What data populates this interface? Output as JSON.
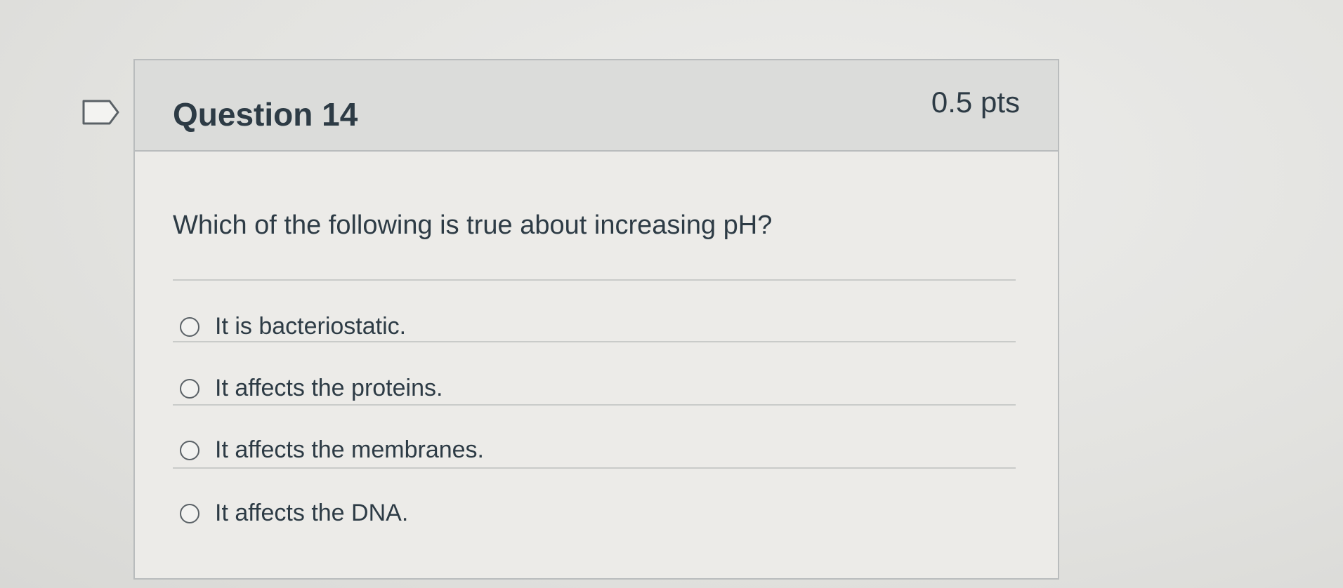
{
  "question": {
    "title": "Question 14",
    "points": "0.5 pts",
    "text": "Which of the following is true about increasing pH?",
    "flag_icon": "flag-outline-icon",
    "answers": [
      {
        "label": "It is bacteriostatic.",
        "selected": false
      },
      {
        "label": "It affects the proteins.",
        "selected": false
      },
      {
        "label": "It affects the membranes.",
        "selected": false
      },
      {
        "label": "It affects the DNA.",
        "selected": false
      }
    ]
  },
  "colors": {
    "text": "#2d3b45",
    "header_bg": "#dbdcda",
    "card_bg": "#ecebe8",
    "border": "#b9bcbd"
  }
}
